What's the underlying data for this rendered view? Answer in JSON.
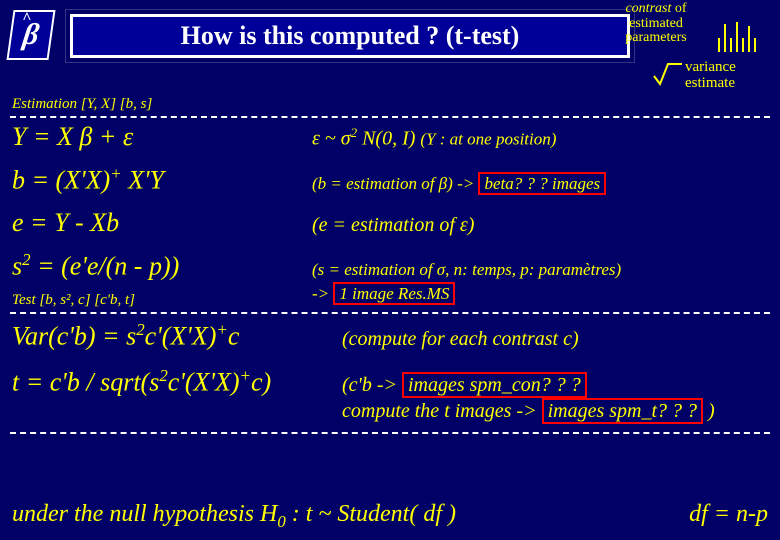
{
  "badge": {
    "symbol": "β",
    "hat": "^"
  },
  "title": "How is this computed ? (t-test)",
  "top_right": {
    "line1_em": "contrast",
    "line1_rest": " of",
    "line2": "estimated",
    "line3": "parameters",
    "var1": "variance",
    "var2": "estimate"
  },
  "sections": {
    "est_label": "Estimation [Y, X] [b, s]",
    "test_label": "Test [b, s², c] [c'b, t]"
  },
  "eq": {
    "model_lhs": "Y = X β + ε",
    "model_rhs_a": "ε ~ σ",
    "model_rhs_b": " N(0, I) ",
    "model_rhs_note": "(Y : at one position)",
    "b_lhs": "b = (X'X)",
    "b_lhs_plus": "+",
    "b_lhs_tail": " X'Y",
    "b_rhs_a": "(b = estimation of β) -> ",
    "b_red": "beta? ? ? images",
    "e_lhs": "e = Y - Xb",
    "e_rhs": "(e = estimation of  ε)",
    "s_lhs_a": "s",
    "s_lhs_b": " = (e'e/(n - p))",
    "s_rhs_a": "(s = estimation of σ, n: temps, p: paramètres)",
    "s_rhs_b": "-> ",
    "s_red": "1 image Res.MS",
    "var_lhs_a": "Var(c'b) = s",
    "var_lhs_b": "c'(X'X)",
    "var_lhs_c": "c",
    "var_rhs": "(compute for each contrast c)",
    "t_lhs_a": "t = c'b / sqrt(s",
    "t_lhs_b": "c'(X'X)",
    "t_lhs_c": "c)",
    "t_rhs_a": "(c'b  -> ",
    "t_red1": "images spm_con? ? ?",
    "t_rhs_b": "compute  the t  images -> ",
    "t_red2": "images spm_t? ? ?",
    "t_rhs_tail": " )"
  },
  "bottom": {
    "null_a": "under the null hypothesis H",
    "null_b": " : t ~ Student( df )",
    "df": "df = n-p"
  }
}
